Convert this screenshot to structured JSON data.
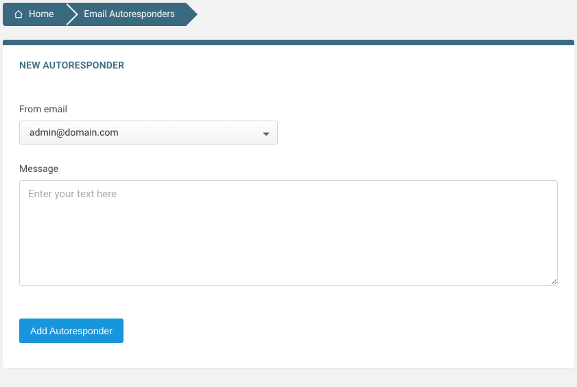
{
  "breadcrumb": {
    "home_label": "Home",
    "current_label": "Email Autoresponders"
  },
  "panel": {
    "title": "NEW AUTORESPONDER"
  },
  "form": {
    "from_email": {
      "label": "From email",
      "value": "admin@domain.com"
    },
    "message": {
      "label": "Message",
      "placeholder": "Enter your text here",
      "value": ""
    },
    "submit_label": "Add Autoresponder"
  }
}
